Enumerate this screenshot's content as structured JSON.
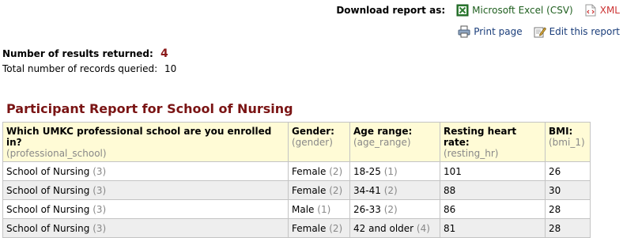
{
  "download": {
    "label": "Download report as:",
    "csv_label": "Microsoft Excel (CSV)",
    "xml_label": "XML"
  },
  "actions": {
    "print_label": "Print page",
    "edit_label": "Edit this report"
  },
  "results": {
    "num_label": "Number of results returned:",
    "num_value": "4",
    "total_label": "Total number of records queried:",
    "total_value": "10"
  },
  "report_title": "Participant Report for School of Nursing",
  "columns": [
    {
      "label": "Which UMKC professional school are you enrolled in?",
      "field": "(professional_school)"
    },
    {
      "label": "Gender:",
      "field": "(gender)"
    },
    {
      "label": "Age range:",
      "field": "(age_range)"
    },
    {
      "label": "Resting heart rate:",
      "field": "(resting_hr)"
    },
    {
      "label": "BMI:",
      "field": "(bmi_1)"
    }
  ],
  "rows": [
    {
      "school": "School of Nursing",
      "school_count": "(3)",
      "gender": "Female",
      "gender_count": "(2)",
      "age": "18-25",
      "age_count": "(1)",
      "hr": "101",
      "bmi": "26"
    },
    {
      "school": "School of Nursing",
      "school_count": "(3)",
      "gender": "Female",
      "gender_count": "(2)",
      "age": "34-41",
      "age_count": "(2)",
      "hr": "88",
      "bmi": "30"
    },
    {
      "school": "School of Nursing",
      "school_count": "(3)",
      "gender": "Male",
      "gender_count": "(1)",
      "age": "26-33",
      "age_count": "(2)",
      "hr": "86",
      "bmi": "28"
    },
    {
      "school": "School of Nursing",
      "school_count": "(3)",
      "gender": "Female",
      "gender_count": "(2)",
      "age": "42 and older",
      "age_count": "(4)",
      "hr": "81",
      "bmi": "28"
    }
  ],
  "colors": {
    "title": "#7a1414",
    "header_bg": "#fffbd6",
    "even_row_bg": "#eeeeee",
    "count_gray": "#888888"
  },
  "icons": {
    "csv": "excel-icon",
    "xml": "xml-icon",
    "print": "printer-icon",
    "edit": "edit-pencil-icon"
  }
}
